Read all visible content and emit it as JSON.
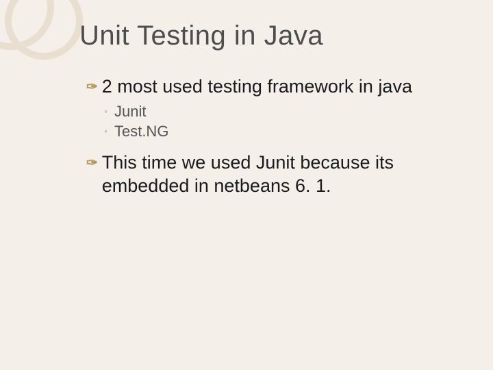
{
  "title": "Unit Testing in Java",
  "bullets": [
    {
      "text": "2 most used testing framework in java",
      "subitems": [
        {
          "text": "Junit"
        },
        {
          "text": "Test.NG"
        }
      ]
    },
    {
      "text": "This time we used Junit because its embedded in netbeans 6. 1.",
      "subitems": []
    }
  ]
}
